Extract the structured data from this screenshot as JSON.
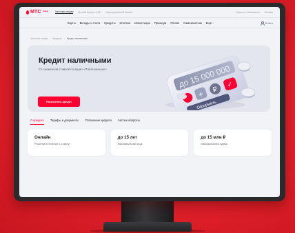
{
  "brand": {
    "logo_text": "МТС",
    "logo_sub": "Банк",
    "accent": "#ff0032"
  },
  "topbar": {
    "segments": [
      {
        "label": "Частным лицам",
        "active": true
      },
      {
        "label": "Малый бизнес и ИП",
        "active": false
      },
      {
        "label": "Корпоративный бизнес",
        "active": false
      }
    ],
    "right": [
      "Офисы и банкоматы",
      "Москва"
    ]
  },
  "nav": {
    "items": [
      "Карты",
      "Вклады и счета",
      "Кредиты",
      "Ипотека",
      "Инвестиции",
      "Премиум",
      "Private",
      "Самозанятым",
      "Ещё"
    ],
    "more_icon": "chevron-down-icon",
    "login_icon": "user-icon",
    "login_label": "Войти"
  },
  "breadcrumb": {
    "items": [
      "Частным лицам",
      "Кредиты",
      "Кредит наличными"
    ],
    "separator": "›"
  },
  "hero": {
    "title": "Кредит наличными",
    "subtitle": "Со сниженной ставкой по акции «Плати меньше»",
    "cta_label": "Рассчитать кредит",
    "calculator": {
      "display": "до 15 000 000",
      "symbols": [
        "₽",
        "+",
        "✓"
      ],
      "button_label": "Оформить"
    }
  },
  "tabs": [
    {
      "label": "О кредите",
      "active": true
    },
    {
      "label": "Тарифы и документы",
      "active": false
    },
    {
      "label": "Погашение кредита",
      "active": false
    },
    {
      "label": "Частые вопросы",
      "active": false
    }
  ],
  "cards": [
    {
      "title": "Онлайн",
      "subtitle": "Решение в течение 2-х минут"
    },
    {
      "title": "до 15 лет",
      "subtitle": "Максимальный срок"
    },
    {
      "title": "до 15 млн ₽",
      "subtitle": "Максимальная сумма"
    }
  ]
}
